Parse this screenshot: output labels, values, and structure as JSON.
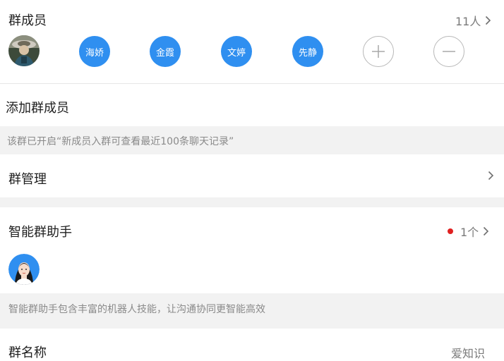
{
  "members_section": {
    "title": "群成员",
    "count": "11人",
    "members": [
      {
        "name": "海娇",
        "color": "#2f8ff0"
      },
      {
        "name": "金霞",
        "color": "#2f8ff0"
      },
      {
        "name": "文婷",
        "color": "#2f8ff0"
      },
      {
        "name": "先静",
        "color": "#2f8ff0"
      }
    ]
  },
  "add_members": {
    "label": "添加群成员",
    "notice": "该群已开启“新成员入群可查看最近100条聊天记录”"
  },
  "group_manage": {
    "label": "群管理"
  },
  "assistant": {
    "title": "智能群助手",
    "count": "1个",
    "dot_color": "#e02020",
    "description": "智能群助手包含丰富的机器人技能，让沟通协同更智能高效"
  },
  "group_name": {
    "label": "群名称",
    "value": "爱知识"
  },
  "colors": {
    "accent": "#2f8ff0",
    "background_gray": "#f2f2f2"
  }
}
